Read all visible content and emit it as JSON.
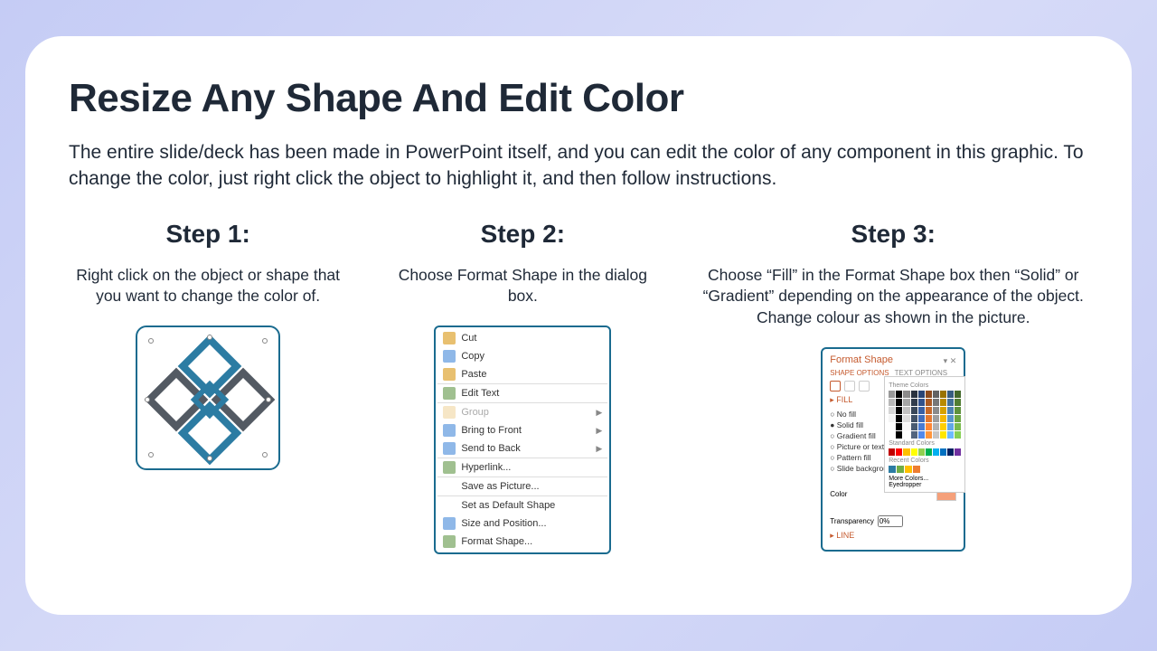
{
  "title": "Resize Any Shape And Edit Color",
  "description": "The entire slide/deck has been made in PowerPoint itself, and you can edit the color of any component in this graphic. To change the color, just right click the object to highlight it, and then follow instructions.",
  "steps": [
    {
      "heading": "Step 1:",
      "text": "Right click on the object or shape that you want to change the color of."
    },
    {
      "heading": "Step 2:",
      "text": "Choose Format Shape in the dialog box."
    },
    {
      "heading": "Step 3:",
      "text": "Choose “Fill” in the Format Shape box then “Solid” or “Gradient” depending on the appearance of the object. Change colour as shown in the picture."
    }
  ],
  "context_menu": {
    "items": [
      {
        "label": "Cut"
      },
      {
        "label": "Copy"
      },
      {
        "label": "Paste"
      },
      {
        "label": "Edit Text",
        "sep": true
      },
      {
        "label": "Group",
        "disabled": true,
        "arrow": true,
        "sep": true
      },
      {
        "label": "Bring to Front",
        "arrow": true
      },
      {
        "label": "Send to Back",
        "arrow": true
      },
      {
        "label": "Hyperlink...",
        "sep": true
      },
      {
        "label": "Save as Picture...",
        "sep": true
      },
      {
        "label": "Set as Default Shape",
        "sep": true
      },
      {
        "label": "Size and Position..."
      },
      {
        "label": "Format Shape..."
      }
    ]
  },
  "format_panel": {
    "title": "Format Shape",
    "tab_shape": "SHAPE OPTIONS",
    "tab_text": "TEXT OPTIONS",
    "section_fill": "FILL",
    "radios": [
      "No fill",
      "Solid fill",
      "Gradient fill",
      "Picture or texture fill",
      "Pattern fill",
      "Slide background fill"
    ],
    "color_label": "Color",
    "trans_label": "Transparency",
    "trans_value": "0%",
    "section_line": "LINE",
    "popup": {
      "theme": "Theme Colors",
      "standard": "Standard Colors",
      "recent": "Recent Colors",
      "more": "More Colors...",
      "eyedrop": "Eyedropper"
    }
  }
}
